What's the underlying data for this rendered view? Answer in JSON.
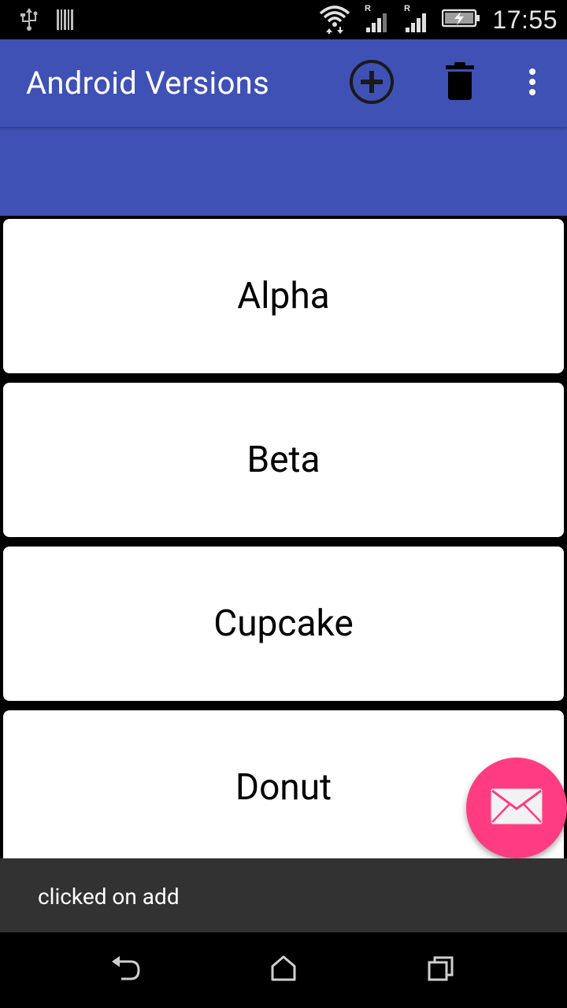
{
  "status_bar": {
    "time": "17:55",
    "icons": [
      "usb-icon",
      "barcode-icon",
      "wifi-icon",
      "signal-icon",
      "signal-icon",
      "battery-charging-icon"
    ],
    "roaming_label": "R"
  },
  "app_bar": {
    "title": "Android Versions",
    "actions": [
      "add-circle-icon",
      "delete-icon",
      "overflow-menu-icon"
    ],
    "color": "#3f51b5"
  },
  "list": {
    "items": [
      {
        "label": "Alpha"
      },
      {
        "label": "Beta"
      },
      {
        "label": "Cupcake"
      },
      {
        "label": "Donut"
      }
    ]
  },
  "fab": {
    "icon": "mail-icon",
    "color": "#ff3c82"
  },
  "snackbar": {
    "message": "clicked on add"
  },
  "nav_bar": {
    "buttons": [
      "back-icon",
      "home-icon",
      "recents-icon"
    ]
  }
}
